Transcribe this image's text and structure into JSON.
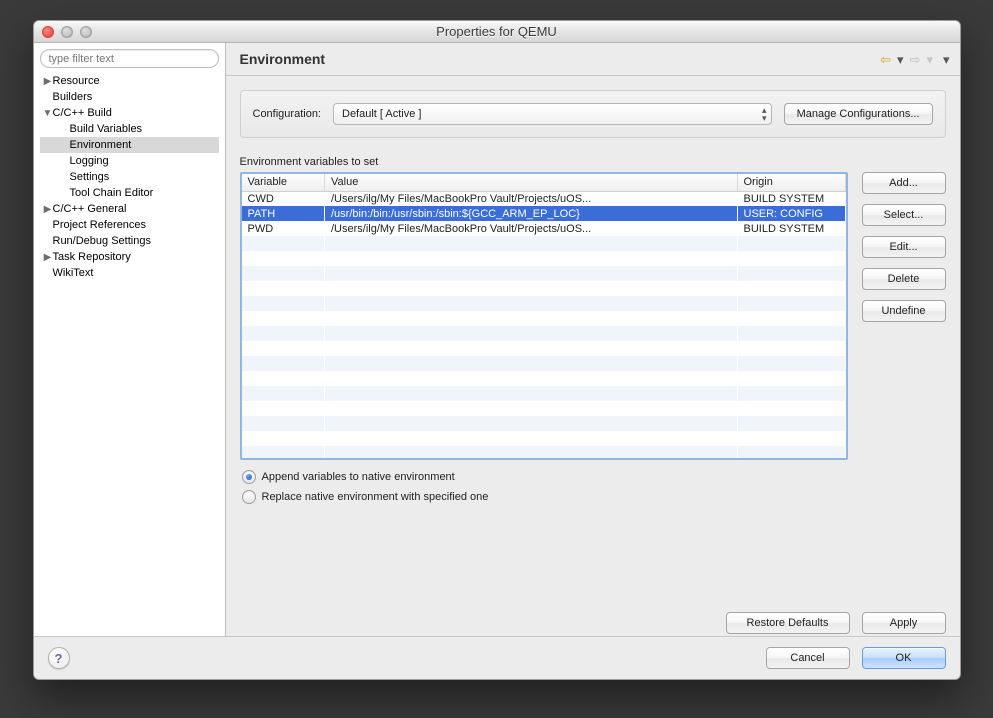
{
  "window": {
    "title": "Properties for QEMU"
  },
  "filter_placeholder": "type filter text",
  "tree": [
    {
      "label": "Resource",
      "level": 1,
      "arrow": "▶"
    },
    {
      "label": "Builders",
      "level": 1,
      "arrow": ""
    },
    {
      "label": "C/C++ Build",
      "level": 1,
      "arrow": "▼"
    },
    {
      "label": "Build Variables",
      "level": 3,
      "arrow": ""
    },
    {
      "label": "Environment",
      "level": 3,
      "arrow": "",
      "selected": true
    },
    {
      "label": "Logging",
      "level": 3,
      "arrow": ""
    },
    {
      "label": "Settings",
      "level": 3,
      "arrow": ""
    },
    {
      "label": "Tool Chain Editor",
      "level": 3,
      "arrow": ""
    },
    {
      "label": "C/C++ General",
      "level": 1,
      "arrow": "▶"
    },
    {
      "label": "Project References",
      "level": 1,
      "arrow": ""
    },
    {
      "label": "Run/Debug Settings",
      "level": 1,
      "arrow": ""
    },
    {
      "label": "Task Repository",
      "level": 1,
      "arrow": "▶"
    },
    {
      "label": "WikiText",
      "level": 1,
      "arrow": ""
    }
  ],
  "heading": "Environment",
  "config": {
    "label": "Configuration:",
    "value": "Default  [ Active ]",
    "manage_btn": "Manage Configurations..."
  },
  "table": {
    "caption": "Environment variables to set",
    "columns": [
      "Variable",
      "Value",
      "Origin"
    ],
    "rows": [
      {
        "variable": "CWD",
        "value": "/Users/ilg/My Files/MacBookPro Vault/Projects/uOS...",
        "origin": "BUILD SYSTEM",
        "selected": false
      },
      {
        "variable": "PATH",
        "value": "/usr/bin:/bin:/usr/sbin:/sbin:${GCC_ARM_EP_LOC}",
        "origin": "USER: CONFIG",
        "selected": true
      },
      {
        "variable": "PWD",
        "value": "/Users/ilg/My Files/MacBookPro Vault/Projects/uOS...",
        "origin": "BUILD SYSTEM",
        "selected": false
      }
    ],
    "buttons": [
      "Add...",
      "Select...",
      "Edit...",
      "Delete",
      "Undefine"
    ]
  },
  "radios": {
    "append": "Append variables to native environment",
    "replace": "Replace native environment with specified one",
    "selected": "append"
  },
  "lower": {
    "restore": "Restore Defaults",
    "apply": "Apply"
  },
  "footer": {
    "cancel": "Cancel",
    "ok": "OK"
  }
}
